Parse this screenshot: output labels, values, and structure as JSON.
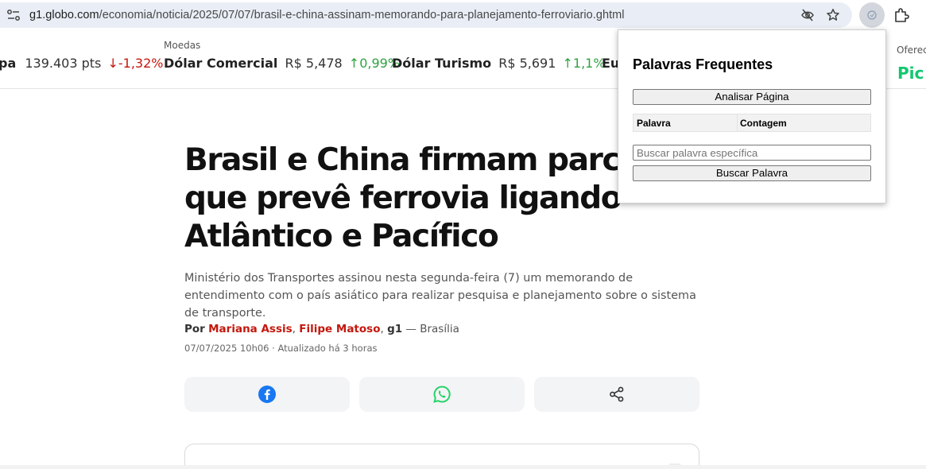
{
  "browser": {
    "url_host": "g1.globo.com",
    "url_path": "/economia/noticia/2025/07/07/brasil-e-china-assinam-memorando-para-planejamento-ferroviario.ghtml",
    "icons": [
      "site-info-icon",
      "eye-off-icon",
      "star-icon",
      "extension-active-icon",
      "puzzle-icon"
    ]
  },
  "ticker": {
    "group_label": "Moedas",
    "items": [
      {
        "name": "pa",
        "value": "139.403 pts",
        "arrow": "↓",
        "change": "-1,32%",
        "direction": "down"
      },
      {
        "name": "Dólar Comercial",
        "value": "R$ 5,478",
        "arrow": "↑",
        "change": "0,99%",
        "direction": "up"
      },
      {
        "name": "Dólar Turismo",
        "value": "R$ 5,691",
        "arrow": "↑",
        "change": "1,1%",
        "direction": "up"
      },
      {
        "name": "Eu"
      }
    ],
    "sponsor_label": "Oferec",
    "sponsor_logo": "Pic"
  },
  "article": {
    "headline": "Brasil e China firmam parceria que prevê ferrovia ligando Atlântico e Pacífico",
    "subtitle": "Ministério dos Transportes assinou nesta segunda-feira (7) um memorando de entendimento com o país asiático para realizar pesquisa e planejamento sobre o sistema de transporte.",
    "byline": {
      "prefix": "Por",
      "author1": "Mariana Assis",
      "sep": ",",
      "author2": "Filipe Matoso",
      "sep2": ",",
      "outlet": "g1",
      "location": " — Brasília"
    },
    "date": "07/07/2025 10h06 · Atualizado há 3 horas",
    "share_icons": [
      "facebook-icon",
      "whatsapp-icon",
      "share-icon"
    ]
  },
  "popup": {
    "title": "Palavras Frequentes",
    "analyze_label": "Analisar Página",
    "col_word": "Palavra",
    "col_count": "Contagem",
    "search_placeholder": "Buscar palavra específica",
    "search_value": "",
    "search_label": "Buscar Palavra"
  },
  "colors": {
    "down": "#c4170c",
    "up": "#2ea33f",
    "author": "#c4170c",
    "facebook": "#1877f2",
    "whatsapp": "#25d366",
    "picpay": "#11c76f",
    "omnibox": "#e9eef6"
  }
}
